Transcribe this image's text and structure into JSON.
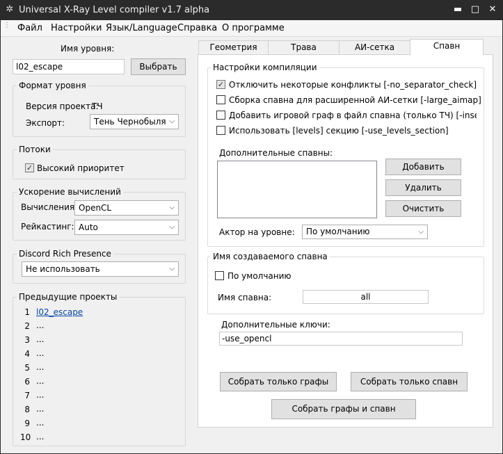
{
  "window": {
    "title": "Universal X-Ray Level compiler v1.7 alpha",
    "minimize_glyph": "▬",
    "maximize_glyph": "□",
    "close_glyph": "✕"
  },
  "menu": {
    "items": [
      "Файл",
      "Настройки",
      "Язык/Language",
      "Справка",
      "О программе"
    ]
  },
  "left": {
    "level_name_label": "Имя уровня:",
    "level_name_value": "l02_escape",
    "choose_button": "Выбрать",
    "format_group": {
      "title": "Формат уровня",
      "version_label": "Версия проекта:",
      "version_value": "ТЧ",
      "export_label": "Экспорт:",
      "export_value": "Тень Чернобыля"
    },
    "threads_group": {
      "title": "Потоки",
      "high_priority_label": "Высокий приоритет",
      "high_priority_checked": true
    },
    "accel_group": {
      "title": "Ускорение вычислений",
      "compute_label": "Вычисления:",
      "compute_value": "OpenCL",
      "raycast_label": "Рейкастинг:",
      "raycast_value": "Auto"
    },
    "discord_group": {
      "title": "Discord Rich Presence",
      "value": "Не использовать"
    },
    "recent_group": {
      "title": "Предыдущие проекты",
      "items": [
        {
          "num": "1",
          "value": "l02_escape"
        },
        {
          "num": "2",
          "value": "..."
        },
        {
          "num": "3",
          "value": "..."
        },
        {
          "num": "4",
          "value": "..."
        },
        {
          "num": "5",
          "value": "..."
        },
        {
          "num": "6",
          "value": "..."
        },
        {
          "num": "7",
          "value": "..."
        },
        {
          "num": "8",
          "value": "..."
        },
        {
          "num": "9",
          "value": "..."
        },
        {
          "num": "10",
          "value": "..."
        }
      ]
    }
  },
  "tabs": {
    "items": [
      "Геометрия",
      "Трава",
      "АИ-сетка",
      "Спавн"
    ],
    "active": "Спавн"
  },
  "spawn": {
    "compile_group": {
      "title": "Настройки компиляции",
      "options": [
        {
          "label": "Отключить некоторые конфликты [-no_separator_check]",
          "checked": true
        },
        {
          "label": "Сборка спавна для расширенной АИ-сетки [-large_aimap]",
          "checked": false
        },
        {
          "label": "Добавить игровой граф в файл спавна (только ТЧ) [-insert_graph",
          "checked": false
        },
        {
          "label": "Использовать [levels] секцию [-use_levels_section]",
          "checked": false
        }
      ],
      "extra_spawns_label": "Дополнительные спавны:",
      "add_button": "Добавить",
      "remove_button": "Удалить",
      "clear_button": "Очистить",
      "actor_label": "Актор на уровне:",
      "actor_value": "По умолчанию"
    },
    "name_group": {
      "title": "Имя создаваемого спавна",
      "default_label": "По умолчанию",
      "default_checked": false,
      "spawn_name_label": "Имя спавна:",
      "spawn_name_value": "all"
    },
    "extra_keys_label": "Дополнительные ключи:",
    "extra_keys_value": "-use_opencl",
    "build_graphs_button": "Собрать только графы",
    "build_spawn_button": "Собрать только спавн",
    "build_both_button": "Собрать графы и спавн"
  },
  "glyphs": {
    "check": "✓",
    "chevron": "⌵",
    "app_icon": "✲",
    "grip": "⋮"
  }
}
